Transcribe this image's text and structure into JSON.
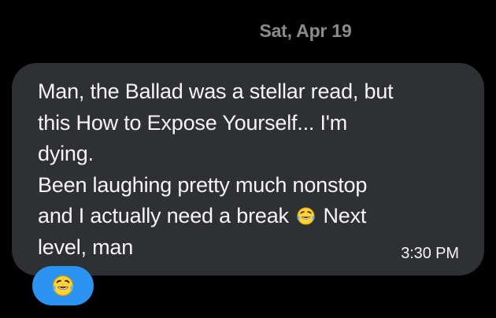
{
  "conversation": {
    "date_label": "Sat, Apr 19"
  },
  "message": {
    "lines": [
      "Man, the Ballad was a stellar read, but",
      "this How to Expose Yourself... I'm",
      "dying.",
      "Been laughing pretty much nonstop",
      "and I actually need a break",
      "Next",
      "level, man"
    ],
    "inline_emoji": "face-with-tears-of-joy",
    "timestamp": "3:30 PM"
  },
  "reaction": {
    "emoji": "face-with-tears-of-joy"
  },
  "colors": {
    "background": "#000000",
    "bubble": "#2f3033",
    "text": "#f5f5f7",
    "muted": "#8b8b8e",
    "reaction": "#2b93f0"
  }
}
